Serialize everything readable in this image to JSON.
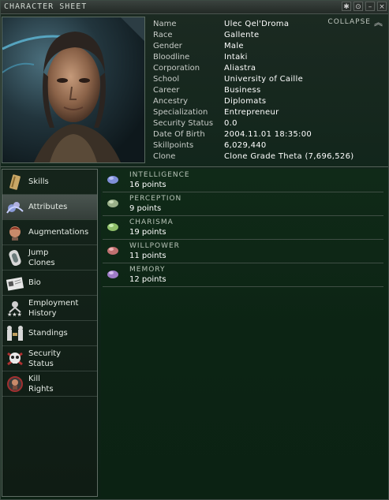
{
  "window": {
    "title": "CHARACTER SHEET",
    "collapse_label": "COLLAPSE",
    "controls": [
      "✱",
      "⊙",
      "–",
      "×"
    ]
  },
  "character": [
    {
      "key": "Name",
      "value": "Ulec Qel'Droma"
    },
    {
      "key": "Race",
      "value": "Gallente"
    },
    {
      "key": "Gender",
      "value": "Male"
    },
    {
      "key": "Bloodline",
      "value": "Intaki"
    },
    {
      "key": "Corporation",
      "value": "Aliastra"
    },
    {
      "key": "School",
      "value": "University of Caille"
    },
    {
      "key": "Career",
      "value": "Business"
    },
    {
      "key": "Ancestry",
      "value": "Diplomats"
    },
    {
      "key": "Specialization",
      "value": "Entrepreneur"
    },
    {
      "key": "Security Status",
      "value": "0.0"
    },
    {
      "key": "Date Of Birth",
      "value": "2004.11.01 18:35:00"
    },
    {
      "key": "Skillpoints",
      "value": "6,029,440"
    },
    {
      "key": "Clone",
      "value": "Clone Grade Theta (7,696,526)"
    }
  ],
  "nav": [
    {
      "id": "skills",
      "line1": "Skills",
      "line2": "",
      "icon": "skillbook-icon",
      "active": false
    },
    {
      "id": "attributes",
      "line1": "Attributes",
      "line2": "",
      "icon": "attributes-icon",
      "active": true
    },
    {
      "id": "augmentations",
      "line1": "Augmentations",
      "line2": "",
      "icon": "augmentation-head-icon",
      "active": false
    },
    {
      "id": "jump-clones",
      "line1": "Jump",
      "line2": "Clones",
      "icon": "clone-capsule-icon",
      "active": false
    },
    {
      "id": "bio",
      "line1": "Bio",
      "line2": "",
      "icon": "bio-document-icon",
      "active": false
    },
    {
      "id": "employment-history",
      "line1": "Employment",
      "line2": "History",
      "icon": "employment-icon",
      "active": false
    },
    {
      "id": "standings",
      "line1": "Standings",
      "line2": "",
      "icon": "standings-icon",
      "active": false
    },
    {
      "id": "security-status",
      "line1": "Security",
      "line2": "Status",
      "icon": "skull-icon",
      "active": false
    },
    {
      "id": "kill-rights",
      "line1": "Kill",
      "line2": "Rights",
      "icon": "kill-rights-icon",
      "active": false
    }
  ],
  "attributes": [
    {
      "name": "INTELLIGENCE",
      "value": "16 points",
      "icon": "intelligence-icon",
      "color": "#7f8fd8"
    },
    {
      "name": "PERCEPTION",
      "value": "9 points",
      "icon": "perception-icon",
      "color": "#9ab08a"
    },
    {
      "name": "CHARISMA",
      "value": "19 points",
      "icon": "charisma-icon",
      "color": "#8fbf6a"
    },
    {
      "name": "WILLPOWER",
      "value": "11 points",
      "icon": "willpower-icon",
      "color": "#c07070"
    },
    {
      "name": "MEMORY",
      "value": "12 points",
      "icon": "memory-icon",
      "color": "#a07cc8"
    }
  ]
}
